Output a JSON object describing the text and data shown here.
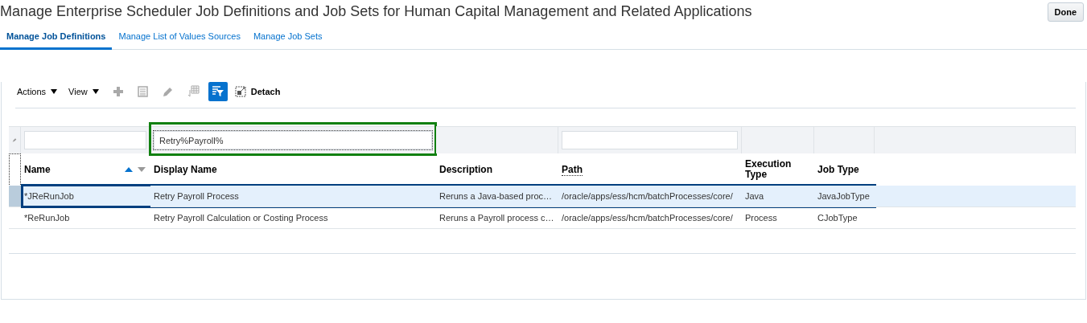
{
  "page": {
    "title": "Manage Enterprise Scheduler Job Definitions and Job Sets for Human Capital Management and Related Applications",
    "done_button": "Done"
  },
  "tabs": [
    {
      "label": "Manage Job Definitions",
      "selected": true
    },
    {
      "label": "Manage List of Values Sources",
      "selected": false
    },
    {
      "label": "Manage Job Sets",
      "selected": false
    }
  ],
  "toolbar": {
    "menus": [
      {
        "label": "Actions"
      },
      {
        "label": "View"
      }
    ],
    "buttons": [
      {
        "kind": "add",
        "disabled": true,
        "selected": false
      },
      {
        "kind": "details",
        "disabled": true,
        "selected": false
      },
      {
        "kind": "edit",
        "disabled": true,
        "selected": false
      },
      {
        "kind": "freeze",
        "disabled": true,
        "selected": false
      },
      {
        "kind": "filter",
        "disabled": false,
        "selected": true
      },
      {
        "kind": "detach",
        "disabled": false,
        "selected": false,
        "label": "Detach"
      }
    ]
  },
  "table": {
    "columns": [
      {
        "label": "Name",
        "sorted": true,
        "dotted_underline": false,
        "filter": {
          "kind": "field",
          "outlined": false
        }
      },
      {
        "label": "Display Name",
        "sorted": false,
        "dotted_underline": false,
        "filter": {
          "kind": "field",
          "value": "Retry%Payroll%",
          "outlined": true
        }
      },
      {
        "label": "Description",
        "sorted": false,
        "dotted_underline": false,
        "filter": {
          "kind": "none"
        }
      },
      {
        "label": "Path",
        "sorted": false,
        "dotted_underline": true,
        "filter": {
          "kind": "field",
          "outlined": false
        }
      },
      {
        "label": "Execution Type",
        "sorted": false,
        "dotted_underline": false,
        "filter": {
          "kind": "none"
        }
      },
      {
        "label": "Job Type",
        "sorted": false,
        "dotted_underline": false,
        "filter": {
          "kind": "none"
        }
      }
    ],
    "rows": [
      {
        "selected": true,
        "outlined": true,
        "cells": [
          "*JReRunJob",
          "Retry Payroll Process",
          "Reruns a Java-based proc…",
          "/oracle/apps/ess/hcm/batchProcesses/core/",
          "Java",
          "JavaJobType"
        ]
      },
      {
        "selected": false,
        "outlined": false,
        "cells": [
          "*ReRunJob",
          "Retry Payroll Calculation or Costing Process",
          "Reruns a Payroll process c…",
          "/oracle/apps/ess/hcm/batchProcesses/core/",
          "Process",
          "CJobType"
        ]
      }
    ]
  }
}
